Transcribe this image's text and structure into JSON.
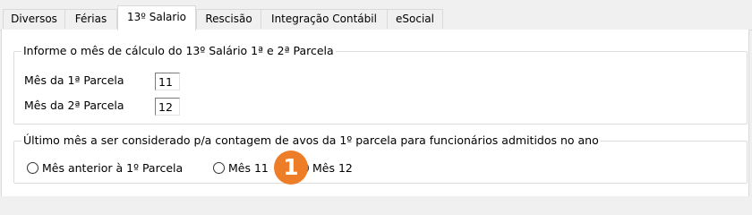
{
  "tabs": [
    {
      "label": "Diversos",
      "active": false
    },
    {
      "label": "Férias",
      "active": false
    },
    {
      "label": "13º Salario",
      "active": true
    },
    {
      "label": "Rescisão",
      "active": false
    },
    {
      "label": "Integração Contábil",
      "active": false
    },
    {
      "label": "eSocial",
      "active": false
    }
  ],
  "calculation_group": {
    "title": "Informe o mês de cálculo do 13º Salário 1ª e 2ª Parcela",
    "first_installment": {
      "label": "Mês da 1ª Parcela",
      "value": "11"
    },
    "second_installment": {
      "label": "Mês da 2ª Parcela",
      "value": "12"
    }
  },
  "months_group": {
    "title": "Último mês a ser considerado p/a contagem de avos da 1º parcela para funcionários admitidos no ano",
    "options": [
      {
        "label": "Mês anterior à 1º Parcela",
        "selected": false
      },
      {
        "label": "Mês 11",
        "selected": false
      },
      {
        "label": "Mês 12",
        "selected": false
      }
    ]
  },
  "step_badge": {
    "label": "1",
    "color": "#ee7d27"
  }
}
